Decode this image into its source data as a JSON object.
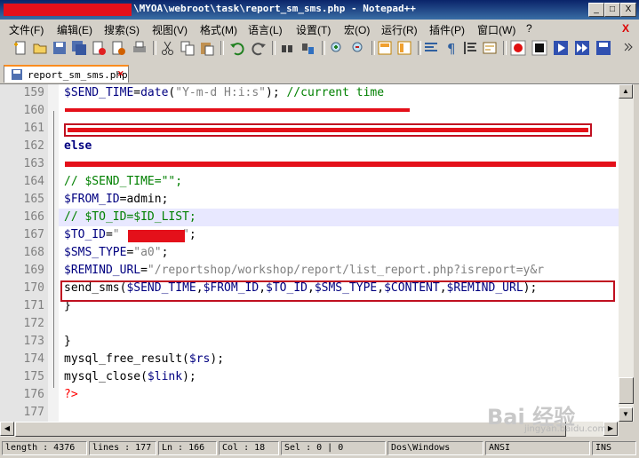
{
  "window": {
    "title": "\\MYOA\\webroot\\task\\report_sm_sms.php - Notepad++",
    "buttons": [
      "_",
      "□",
      "X"
    ]
  },
  "menu": {
    "items": [
      "文件(F)",
      "编辑(E)",
      "搜索(S)",
      "视图(V)",
      "格式(M)",
      "语言(L)",
      "设置(T)",
      "宏(O)",
      "运行(R)",
      "插件(P)",
      "窗口(W)",
      "?"
    ],
    "close": "X"
  },
  "tab": {
    "label": "report_sm_sms.php"
  },
  "editor": {
    "lines": [
      {
        "n": "159",
        "html": "<span class=\"v\">$SEND_TIME</span>=<span class=\"k\" style=\"font-weight:normal\">date</span>(<span class=\"s\">\"Y-m-d H:i:s\"</span>); <span class=\"c\">//current time</span>"
      },
      {
        "n": "160",
        "html": ""
      },
      {
        "n": "161",
        "html": ""
      },
      {
        "n": "162",
        "html": "<span class=\"k\">else</span>"
      },
      {
        "n": "163",
        "html": ""
      },
      {
        "n": "164",
        "html": "<span class=\"c\">// $SEND_TIME=\"\";</span>"
      },
      {
        "n": "165",
        "html": "<span class=\"v\">$FROM_ID</span>=admin;"
      },
      {
        "n": "166",
        "html": "<span class=\"c\">// $TO_ID=$ID_LIST;</span>"
      },
      {
        "n": "167",
        "html": "<span class=\"v\">$TO_ID</span>=<span class=\"s\">\"</span>         <span class=\"s\">\"</span>;"
      },
      {
        "n": "168",
        "html": "<span class=\"v\">$SMS_TYPE</span>=<span class=\"s\">\"a0\"</span>;"
      },
      {
        "n": "169",
        "html": "<span class=\"v\">$REMIND_URL</span>=<span class=\"s\">\"/reportshop/workshop/report/list_report.php?isreport=y&amp;r</span>"
      },
      {
        "n": "170",
        "html": "send_sms(<span class=\"v\">$SEND_TIME</span>,<span class=\"v\">$FROM_ID</span>,<span class=\"v\">$TO_ID</span>,<span class=\"v\">$SMS_TYPE</span>,<span class=\"v\">$CONTENT</span>,<span class=\"v\">$REMIND_URL</span>);"
      },
      {
        "n": "171",
        "html": "}"
      },
      {
        "n": "172",
        "html": ""
      },
      {
        "n": "173",
        "html": "}"
      },
      {
        "n": "174",
        "html": "mysql_free_result(<span class=\"v\">$rs</span>);"
      },
      {
        "n": "175",
        "html": "mysql_close(<span class=\"v\">$link</span>);"
      },
      {
        "n": "176",
        "html": "<span class=\"ph\">?&gt;</span>"
      },
      {
        "n": "177",
        "html": ""
      }
    ],
    "current_line": "166"
  },
  "status": {
    "length": "length : 4376",
    "lines": "lines : 177",
    "ln": "Ln : 166",
    "col": "Col : 18",
    "sel": "Sel : 0 | 0",
    "eol": "Dos\\Windows",
    "encoding": "ANSI",
    "mode": "INS"
  },
  "watermark": {
    "text": "Bai 经验",
    "sub": "jingyan.baidu.com"
  }
}
